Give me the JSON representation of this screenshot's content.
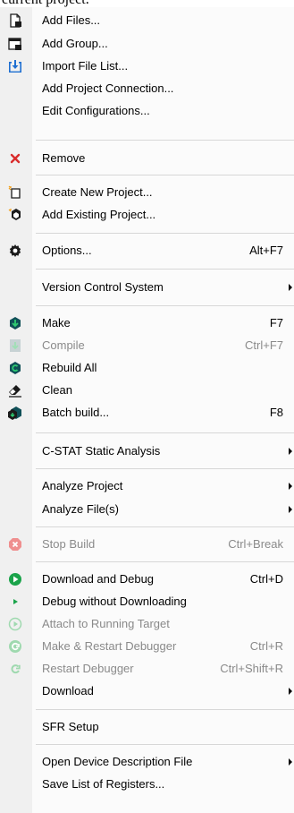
{
  "header_fragment": "current project.",
  "menu": {
    "items": [
      {
        "label": "Add Files...",
        "icon": "add-files-icon"
      },
      {
        "label": "Add Group...",
        "icon": "add-group-icon"
      },
      {
        "label": "Import File List...",
        "icon": "import-file-list-icon"
      },
      {
        "label": "Add Project Connection...",
        "icon": null
      },
      {
        "label": "Edit Configurations...",
        "icon": null
      },
      {
        "label": "Remove",
        "icon": "remove-x-icon"
      },
      {
        "label": "Create New Project...",
        "icon": "create-new-project-icon"
      },
      {
        "label": "Add Existing Project...",
        "icon": "add-existing-project-icon"
      },
      {
        "label": "Options...",
        "shortcut": "Alt+F7",
        "icon": "gear-icon"
      },
      {
        "label": "Version Control System",
        "submenu": true
      },
      {
        "label": "Make",
        "shortcut": "F7",
        "icon": "make-icon"
      },
      {
        "label": "Compile",
        "shortcut": "Ctrl+F7",
        "icon": "compile-icon",
        "disabled": true
      },
      {
        "label": "Rebuild All",
        "icon": "rebuild-all-icon"
      },
      {
        "label": "Clean",
        "icon": "clean-eraser-icon"
      },
      {
        "label": "Batch build...",
        "shortcut": "F8",
        "icon": "batch-build-icon"
      },
      {
        "label": "C-STAT Static Analysis",
        "submenu": true
      },
      {
        "label": "Analyze Project",
        "submenu": true
      },
      {
        "label": "Analyze File(s)",
        "submenu": true
      },
      {
        "label": "Stop Build",
        "shortcut": "Ctrl+Break",
        "icon": "stop-build-icon",
        "disabled": true
      },
      {
        "label": "Download and Debug",
        "shortcut": "Ctrl+D",
        "icon": "download-and-debug-icon"
      },
      {
        "label": "Debug without Downloading",
        "icon": "debug-without-downloading-icon"
      },
      {
        "label": "Attach to Running Target",
        "icon": "attach-to-target-icon",
        "disabled": true
      },
      {
        "label": "Make & Restart Debugger",
        "shortcut": "Ctrl+R",
        "icon": "make-restart-debugger-icon",
        "disabled": true
      },
      {
        "label": "Restart Debugger",
        "shortcut": "Ctrl+Shift+R",
        "icon": "restart-debugger-icon",
        "disabled": true
      },
      {
        "label": "Download",
        "submenu": true
      },
      {
        "label": "SFR Setup"
      },
      {
        "label": "Open Device Description File",
        "submenu": true
      },
      {
        "label": "Save List of Registers..."
      }
    ]
  },
  "colors": {
    "gutter": "#f0f0f0",
    "separator": "#d7d7d7",
    "disabled_text": "#8a8a8a",
    "accent_blue": "#1e6fd1",
    "accent_green": "#1aa34a",
    "accent_red": "#d92c2c",
    "dark_teal": "#0f4f57"
  }
}
